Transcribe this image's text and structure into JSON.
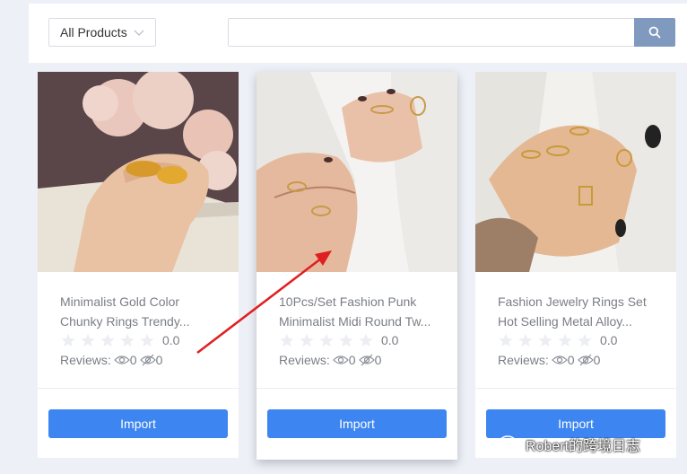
{
  "toolbar": {
    "category": "All Products",
    "search_placeholder": "",
    "search_value": ""
  },
  "products": [
    {
      "title_line1": "Minimalist Gold Color",
      "title_line2": "Chunky Rings Trendy...",
      "rating": "0.0",
      "reviews_label": "Reviews:",
      "views": "0",
      "hidden": "0",
      "import_label": "Import"
    },
    {
      "title_line1": "10Pcs/Set Fashion Punk",
      "title_line2": "Minimalist Midi Round Tw...",
      "rating": "0.0",
      "reviews_label": "Reviews:",
      "views": "0",
      "hidden": "0",
      "import_label": "Import"
    },
    {
      "title_line1": "Fashion Jewelry Rings Set",
      "title_line2": "Hot Selling Metal Alloy...",
      "rating": "0.0",
      "reviews_label": "Reviews:",
      "views": "0",
      "hidden": "0",
      "import_label": "Import"
    }
  ],
  "watermark": "Robert的跨境日志",
  "colors": {
    "accent": "#3d85f0",
    "search_button": "#7f99bf",
    "arrow": "#e02020"
  }
}
